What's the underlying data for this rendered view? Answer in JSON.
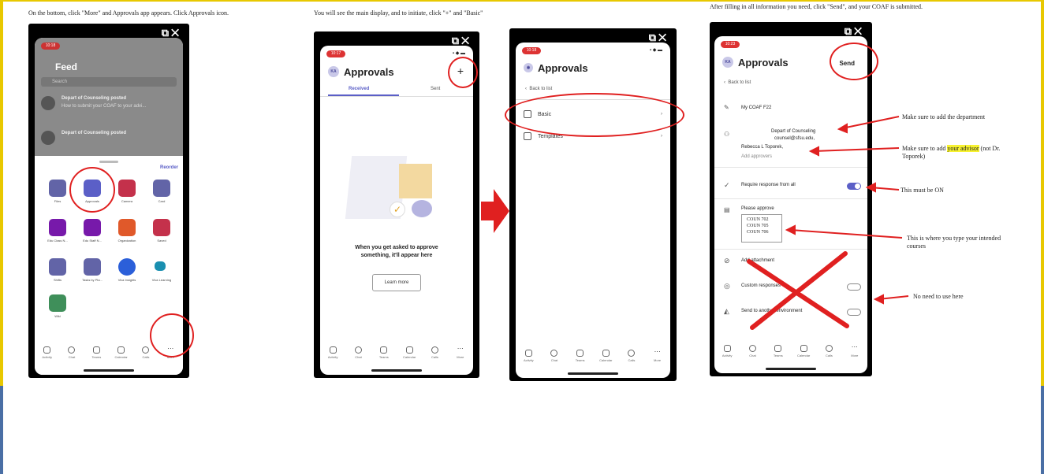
{
  "captions": {
    "step1": "On the bottom, click \"More\" and Approvals app appears. Click Approvals icon.",
    "step2": "You will see the main display, and to initiate, click \"+\" and \"Basic\"",
    "step3": "After filling in all information you need, click \"Send\", and your COAF is submitted."
  },
  "phone1": {
    "time": "10:18",
    "feed_title": "Feed",
    "search": "Search",
    "post1_title": "Depart of Counseling posted",
    "post1_text": "How to submit your COAF to your advi...",
    "post2_title": "Depart of Counseling posted",
    "reorder": "Reorder",
    "apps": [
      "Files",
      "Approvals",
      "Camera",
      "Card",
      "Edu Class N...",
      "Edu Staff N...",
      "Organization",
      "Saved",
      "Shifts",
      "Tasks by Pla...",
      "Viva Insights",
      "Viva Learning",
      "Wiki"
    ],
    "tabs": [
      "Activity",
      "Chat",
      "Teams",
      "Calendar",
      "Calls",
      "More"
    ]
  },
  "phone2": {
    "time": "10:17",
    "avatar": "KA",
    "title": "Approvals",
    "plus": "+",
    "tab_received": "Received",
    "tab_sent": "Sent",
    "empty_text": "When you get asked to approve something, it'll appear here",
    "learn_more": "Learn more",
    "tabs": [
      "Activity",
      "Chat",
      "Teams",
      "Calendar",
      "Calls",
      "More"
    ]
  },
  "phone3": {
    "time": "10:18",
    "title": "Approvals",
    "back": "Back to list",
    "basic": "Basic",
    "templates": "Templates",
    "tabs": [
      "Activity",
      "Chat",
      "Teams",
      "Calendar",
      "Calls",
      "More"
    ]
  },
  "phone4": {
    "time": "10:23",
    "avatar": "KA",
    "title": "Approvals",
    "send": "Send",
    "back": "Back to list",
    "form_name": "My COAF F22",
    "approver1": "Depart of Counseling",
    "approver1_email": "counsel@sfsu.edu,",
    "approver2": "Rebecca L Toporek,",
    "add_approvers": "Add approvers",
    "require": "Require response from all",
    "please_approve": "Please approve",
    "courses": [
      "COUN 702",
      "COUN 705",
      "COUN 706"
    ],
    "attachment": "Add attachment",
    "custom": "Custom responses",
    "send_env": "Send to another environment",
    "tabs": [
      "Activity",
      "Chat",
      "Teams",
      "Calendar",
      "Calls",
      "More"
    ]
  },
  "annotations": {
    "dept": "Make sure to add the department",
    "advisor_pre": "Make sure to add ",
    "advisor_hl": "your advisor",
    "advisor_post": " (not Dr.",
    "advisor_line2": "Toporek)",
    "on": "This must be ON",
    "courses_line1": "This is where you type your intended",
    "courses_line2": "courses",
    "no_need": "No need to use here"
  },
  "colors": {
    "accent": "#5b5fc7",
    "annotation_red": "#e02020",
    "highlight": "#f7f230"
  }
}
